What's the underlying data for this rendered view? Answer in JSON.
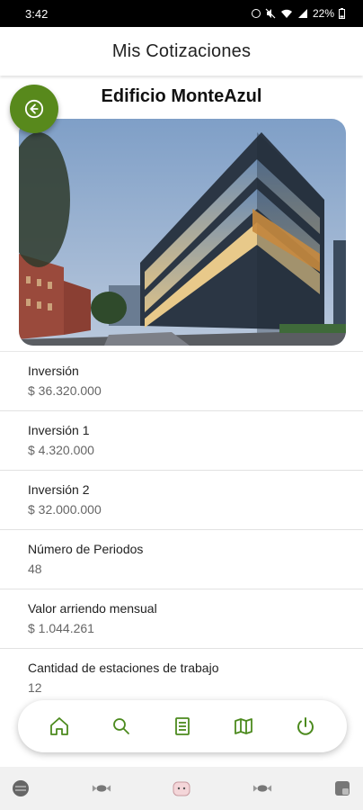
{
  "status_bar": {
    "time": "3:42",
    "battery": "22%"
  },
  "header": {
    "title": "Mis Cotizaciones"
  },
  "property": {
    "name": "Edificio MonteAzul"
  },
  "details": [
    {
      "label": "Inversión",
      "value": "$ 36.320.000"
    },
    {
      "label": "Inversión 1",
      "value": "$ 4.320.000"
    },
    {
      "label": "Inversión 2",
      "value": "$ 32.000.000"
    },
    {
      "label": "Número de Periodos",
      "value": "48"
    },
    {
      "label": "Valor arriendo mensual",
      "value": "$ 1.044.261"
    },
    {
      "label": "Cantidad de estaciones de trabajo",
      "value": "12"
    }
  ],
  "bottom_nav": {
    "items": [
      {
        "icon": "home-icon"
      },
      {
        "icon": "search-icon"
      },
      {
        "icon": "document-icon"
      },
      {
        "icon": "map-icon"
      },
      {
        "icon": "power-icon"
      }
    ]
  },
  "colors": {
    "accent": "#58891c",
    "nav_icon": "#4c8a1e"
  }
}
